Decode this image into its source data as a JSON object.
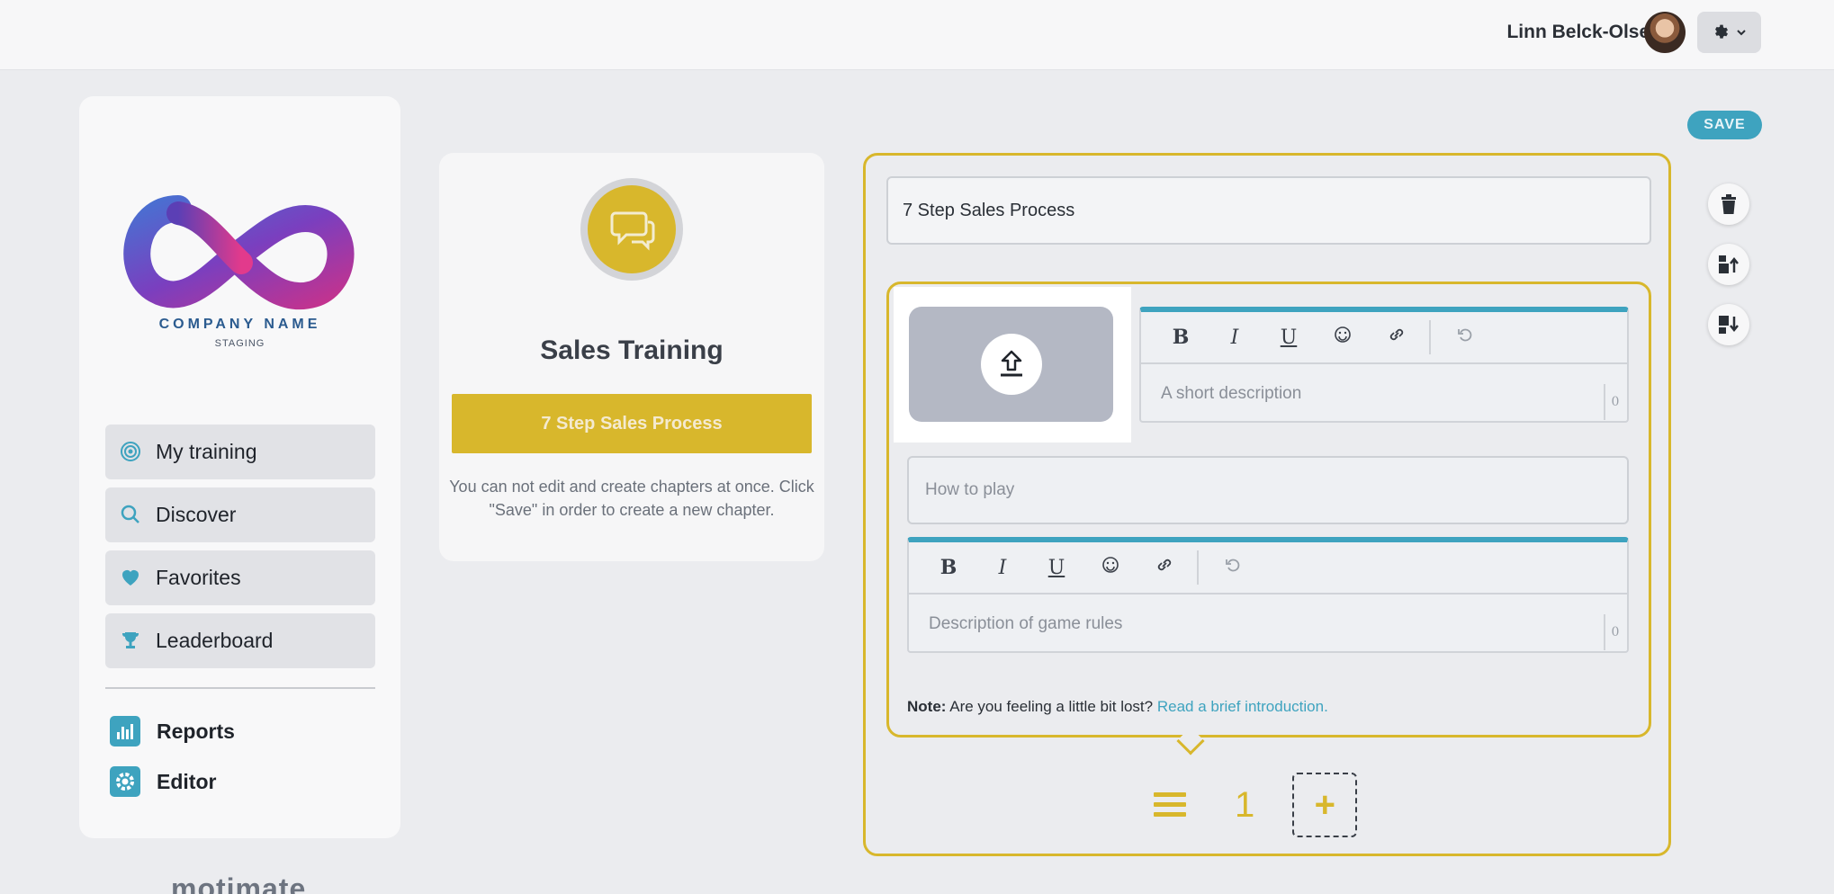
{
  "header": {
    "user_name": "Linn Belck-Olsen"
  },
  "sidebar": {
    "company_name": "COMPANY NAME",
    "company_sub": "STAGING",
    "items": [
      {
        "label": "My training"
      },
      {
        "label": "Discover"
      },
      {
        "label": "Favorites"
      },
      {
        "label": "Leaderboard"
      }
    ],
    "admin_items": [
      {
        "label": "Reports"
      },
      {
        "label": "Editor"
      }
    ],
    "brand": "motimate"
  },
  "course_card": {
    "title": "Sales Training",
    "chapter_button": "7 Step Sales Process",
    "note": "You can not edit and create chapters at once. Click \"Save\" in order to create a new chapter."
  },
  "editor": {
    "save_label": "SAVE",
    "title_value": "7 Step Sales Process",
    "short_description_placeholder": "A short description",
    "how_to_play_placeholder": "How to play",
    "game_rules_placeholder": "Description of game rules",
    "char_count_1": "0",
    "char_count_2": "0",
    "note_label": "Note:",
    "note_text": "Are you feeling a little bit lost?",
    "note_link": "Read a brief introduction.",
    "page_number": "1",
    "add_label": "+"
  },
  "toolbar": {
    "bold": "B",
    "italic": "I",
    "underline": "U"
  },
  "colors": {
    "accent_yellow": "#d8b72c",
    "accent_teal": "#3ea3bf"
  }
}
